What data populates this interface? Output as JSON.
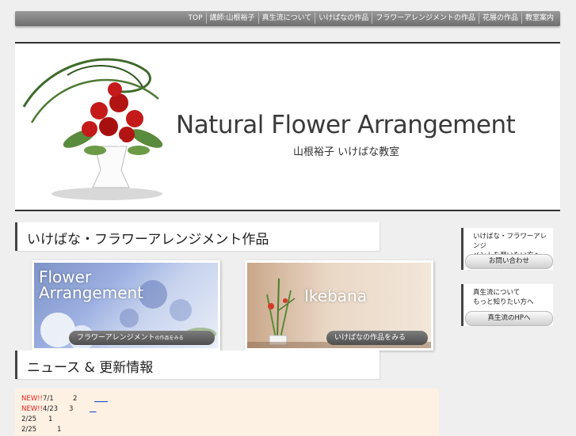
{
  "nav": {
    "items": [
      "TOP",
      "講師:山根裕子",
      "真生流について",
      "いけばなの作品",
      "フラワーアレンジメントの作品",
      "花展の作品",
      "教室案内"
    ]
  },
  "header": {
    "title": "Natural Flower Arrangement",
    "subtitle": "山根裕子 いけばな教室"
  },
  "works": {
    "heading": "いけばな・フラワーアレンジメント作品",
    "flower_card": {
      "title": "Flower\nArrangement",
      "button_main": "フラワーアレンジメント",
      "button_small": "の作品をみる"
    },
    "ikebana_card": {
      "title": "Ikebana",
      "button": "いけばなの作品をみる"
    }
  },
  "news": {
    "heading": "ニュース & 更新情報",
    "items": [
      {
        "badge": "NEW!!",
        "date": "7/1",
        "num": "2",
        "link": "____"
      },
      {
        "badge": "NEW!!",
        "date": "4/23",
        "num": "3",
        "link": "__"
      },
      {
        "badge": "",
        "date": "2/25",
        "num": "1",
        "link": ""
      },
      {
        "badge": "",
        "date": "2/25",
        "num": "1",
        "link": ""
      }
    ]
  },
  "sidebar": {
    "box1": {
      "text": "いけばな・フラワーアレンジ\nメントを習いたい方へ",
      "button": "お問い合わせ"
    },
    "box2": {
      "text": "真生流について\nもっと知りたい方へ",
      "button": "真生流のHPへ"
    }
  },
  "colors": {
    "nav_bg": "#7c7c7c",
    "new_badge": "#e22222",
    "news_bg": "#fdf1e4"
  }
}
